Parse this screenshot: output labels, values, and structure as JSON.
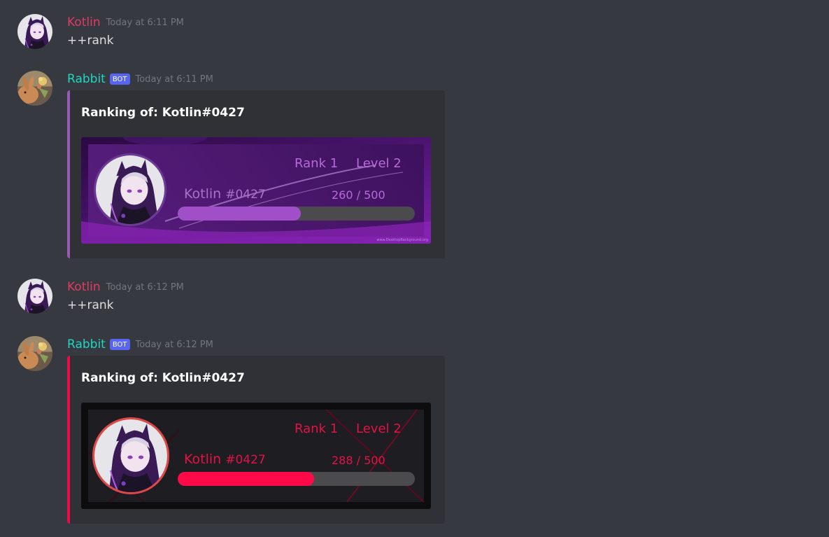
{
  "messages": [
    {
      "author": "Kotlin",
      "timestamp": "Today at 6:11 PM",
      "text": "++rank"
    },
    {
      "author": "Rabbit",
      "badge": "BOT",
      "timestamp": "Today at 6:11 PM",
      "embed": {
        "accent_color": "#9b59b6",
        "title": "Ranking of:  Kotlin#0427",
        "card": {
          "theme": "purple",
          "rank_label": "Rank 1",
          "level_label": "Level  2",
          "username": "Kotlin",
          "discriminator": "#0427",
          "xp_text": "260  / 500",
          "xp_current": 260,
          "xp_max": 500,
          "watermark": "www.DesktopBackground.org"
        }
      }
    },
    {
      "author": "Kotlin",
      "timestamp": "Today at 6:12 PM",
      "text": "++rank"
    },
    {
      "author": "Rabbit",
      "badge": "BOT",
      "timestamp": "Today at 6:12 PM",
      "embed": {
        "accent_color": "#ed0b47",
        "title": "Ranking of:  Kotlin#0427",
        "card": {
          "theme": "red",
          "rank_label": "Rank 1",
          "level_label": "Level  2",
          "username": "Kotlin",
          "discriminator": "#0427",
          "xp_text": "288  / 500",
          "xp_current": 288,
          "xp_max": 500
        }
      }
    }
  ],
  "colors": {
    "background": "#36393f",
    "embed_background": "#2f3136",
    "kotlin_name": "#e03b63",
    "rabbit_name": "#1fd7c2",
    "bot_badge": "#5865f2",
    "timestamp": "#72767d"
  },
  "icons": {
    "kotlin_avatar": "anime-character-avatar-icon",
    "rabbit_avatar": "rabbit-avatar-icon"
  }
}
